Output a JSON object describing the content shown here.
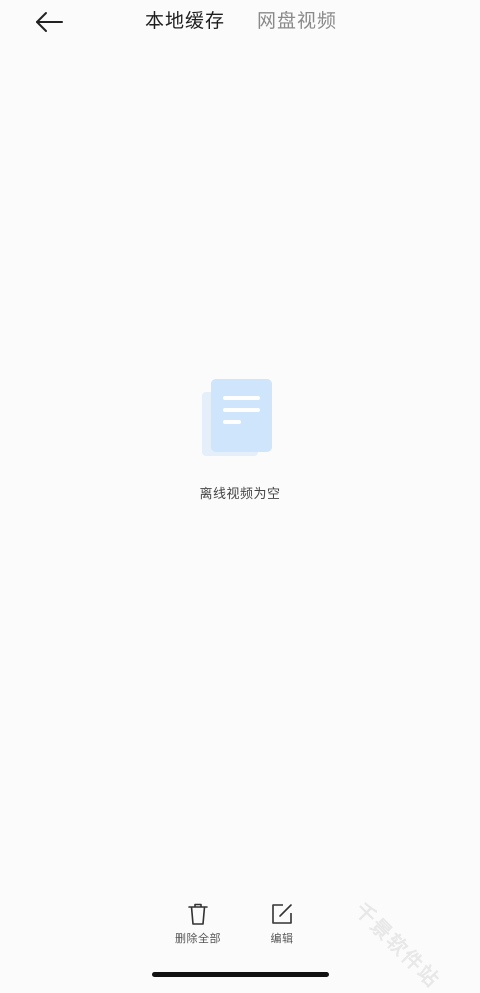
{
  "header": {
    "tabs": [
      {
        "label": "本地缓存",
        "active": true
      },
      {
        "label": "网盘视频",
        "active": false
      }
    ]
  },
  "empty_state": {
    "message": "离线视频为空",
    "icon": "document-icon"
  },
  "bottom_actions": [
    {
      "label": "删除全部",
      "icon": "trash-icon"
    },
    {
      "label": "编辑",
      "icon": "edit-icon"
    }
  ],
  "watermark": "千景软件站",
  "colors": {
    "background": "#fbfbfb",
    "illustration_front": "#cfe5fb",
    "illustration_back": "#e4effa",
    "inactive_tab": "#8a8a8a"
  }
}
